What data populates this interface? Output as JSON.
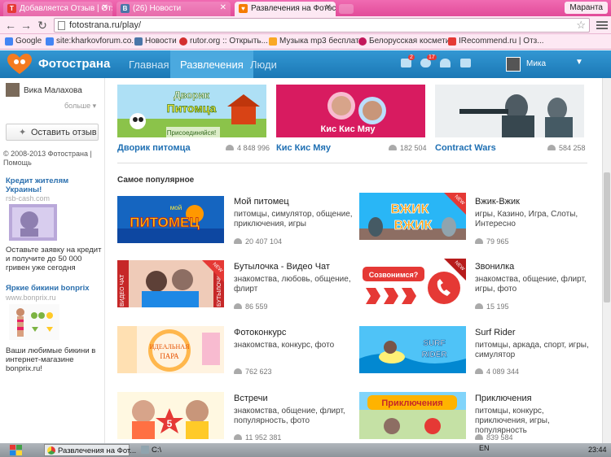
{
  "browser": {
    "tabs": [
      {
        "label": "Добавляется Отзыв | Отз",
        "favicon": "T",
        "favicon_color": "#e53935"
      },
      {
        "label": "(26) Новости",
        "favicon": "В",
        "favicon_color": "#4a76a8"
      },
      {
        "label": "Развлечения на Фотостр",
        "favicon": "♥",
        "favicon_color": "#f57c00"
      }
    ],
    "user_tag": "Маранта",
    "url": "fotostrana.ru/play/",
    "bookmarks": [
      {
        "label": "Google",
        "color": "#4285f4"
      },
      {
        "label": "site:kharkovforum.co...",
        "color": "#4285f4"
      },
      {
        "label": "Новости",
        "color": "#4a76a8"
      },
      {
        "label": "rutor.org :: Открыть...",
        "color": "#d32f2f"
      },
      {
        "label": "Музыка mp3 бесплат...",
        "color": "#f9a825"
      },
      {
        "label": "Белорусская космети...",
        "color": "#c2185b"
      },
      {
        "label": "IRecommend.ru | Отз...",
        "color": "#e53935"
      }
    ]
  },
  "site": {
    "logo": "Фотострана",
    "nav": [
      "Главная",
      "Развлечения",
      "Люди"
    ],
    "active_nav": "Развлечения",
    "badges": [
      "2",
      "17"
    ],
    "username": "Мика"
  },
  "sidebar": {
    "user_name": "Вика Малахова",
    "more_label": "больше",
    "feedback_button": "Оставить отзыв",
    "copyright": "© 2008-2013 Фотострана | Помощь",
    "ads": [
      {
        "title": "Кредит жителям Украины!",
        "url": "rsb-cash.com",
        "text": "Оставьте заявку на кредит и получите до 50 000 гривен уже сегодня"
      },
      {
        "title": "Яркие бикини bonprix",
        "url": "www.bonprix.ru",
        "text": "Ваши любимые бикини в интернет-магазине bonprix.ru!"
      }
    ]
  },
  "featured": [
    {
      "title": "Дворик питомца",
      "count": "4 848 996",
      "banner_text": "Дворик Питомца",
      "banner_sub": "Присоединяйся!"
    },
    {
      "title": "Кис Кис Мяу",
      "count": "182 504",
      "banner_text": "Кис Кис Мяу"
    },
    {
      "title": "Contract Wars",
      "count": "584 258"
    }
  ],
  "popular": {
    "title": "Самое популярное",
    "games": [
      {
        "name": "Мой питомец",
        "tags": "питомцы, симулятор, общение, приключения, игры",
        "count": "20 407 104",
        "banner_text": "ПИТОМЕЦ",
        "banner_small": "мой"
      },
      {
        "name": "Вжик-Вжик",
        "tags": "игры, Казино, Игра, Слоты, Интересно",
        "count": "79 965",
        "banner_text": "ВЖИК ВЖИК",
        "new_label": "NEW"
      },
      {
        "name": "Бутылочка - Видео Чат",
        "tags": "знакомства, любовь, общение, флирт",
        "count": "86 559",
        "banner_left": "ВИДЕО ЧАТ",
        "banner_right": "БУТЫЛОЧКА",
        "new_label": "NEW"
      },
      {
        "name": "Звонилка",
        "tags": "знакомства, общение, флирт, игры, фото",
        "count": "15 195",
        "banner_text": "Созвонимся?",
        "new_label": "NEW"
      },
      {
        "name": "Фотоконкурс",
        "tags": "знакомства, конкурс, фото",
        "count": "762 623",
        "banner_text": "ИДЕАЛЬНАЯ ПАРА"
      },
      {
        "name": "Surf Rider",
        "tags": "питомцы, аркада, спорт, игры, симулятор",
        "count": "4 089 344",
        "banner_text": "SURF RIDER"
      },
      {
        "name": "Встречи",
        "tags": "знакомства, общение, флирт, популярность, фото",
        "count": "11 952 381",
        "banner_text": "5"
      },
      {
        "name": "Приключения",
        "tags": "питомцы, конкурс, приключения, игры, популярность",
        "count": "839 584",
        "banner_text": "Приключения"
      }
    ]
  },
  "taskbar": {
    "tasks": [
      "Развлечения на Фот...",
      "C:\\"
    ],
    "lang": "EN",
    "clock": "23:44"
  }
}
